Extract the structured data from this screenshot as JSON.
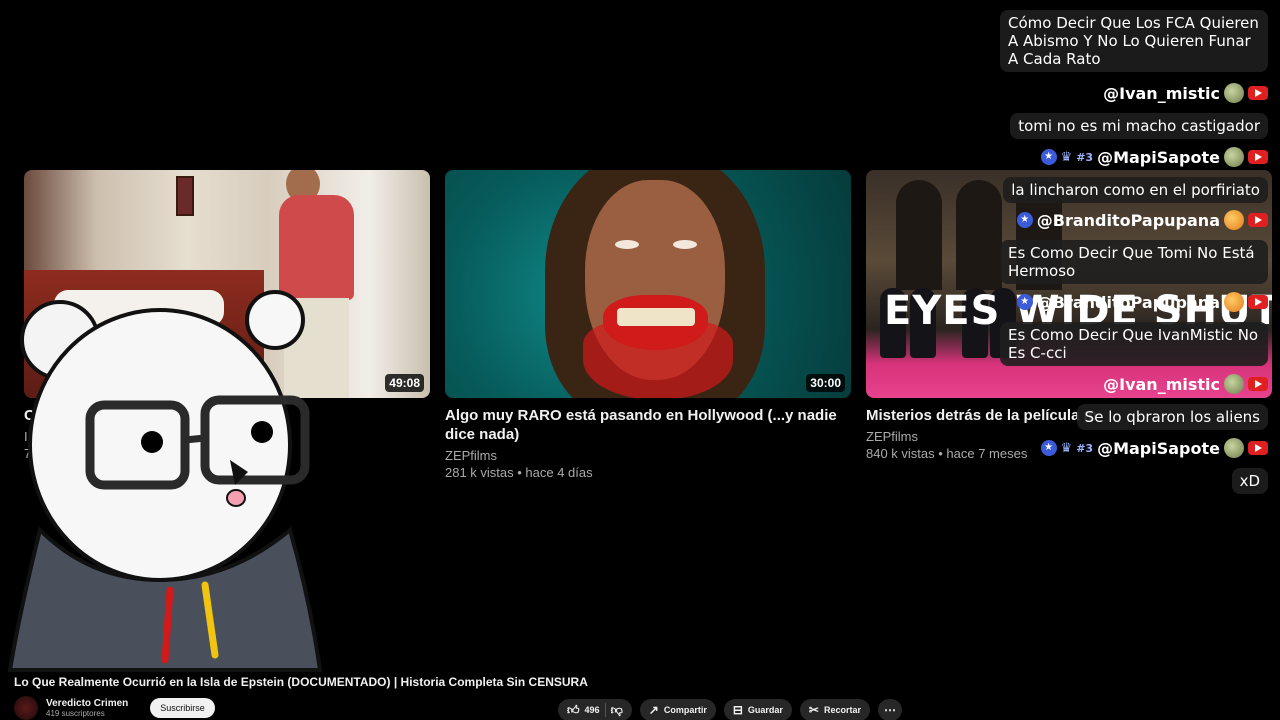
{
  "recommendations": [
    {
      "title": "Ca",
      "channel": "In",
      "meta": "7.",
      "duration": "49:08"
    },
    {
      "title": "Algo muy RARO está pasando en Hollywood (...y nadie dice nada)",
      "channel": "ZEPfilms",
      "meta": "281 k vistas • hace 4 días",
      "duration": "30:00"
    },
    {
      "title": "Misterios detrás de la película m",
      "channel": "ZEPfilms",
      "meta": "840 k vistas • hace 7 meses",
      "thumb_text": "EYES WIDE SHUT"
    }
  ],
  "chat": {
    "messages": [
      {
        "text": "Cómo Decir Que Los FCA Quieren A Abismo Y No Lo Quieren Funar A Cada Rato"
      },
      {
        "author": "@Ivan_mistic",
        "text": "tomi no es mi macho castigador"
      },
      {
        "author": "@MapiSapote",
        "badge": "#3",
        "text": "la lincharon como en el porfiriato"
      },
      {
        "author": "@BranditoPapupana",
        "text": "Es Como Decir Que Tomi No Está Hermoso"
      },
      {
        "author": "@BranditoPapupana",
        "text": "Es Como Decir Que IvanMistic No Es C-cci"
      },
      {
        "author": "@Ivan_mistic",
        "text": "Se lo qbraron los aliens"
      },
      {
        "author": "@MapiSapote",
        "badge": "#3",
        "text": "xD"
      }
    ]
  },
  "video": {
    "title": "Lo Que Realmente Ocurrió en la Isla de Epstein (DOCUMENTADO) | Historia Completa Sin CENSURA",
    "channel_name": "Veredicto Crimen",
    "subscribers": "419 suscriptores",
    "subscribe_label": "Suscribirse",
    "likes": "496",
    "share_label": "Compartir",
    "save_label": "Guardar",
    "clip_label": "Recortar"
  },
  "icons": [
    "thumbs-up-icon",
    "thumbs-down-icon",
    "share-icon",
    "save-icon",
    "scissors-icon",
    "more-icon",
    "youtube-icon",
    "star-badge-icon",
    "crown-icon"
  ]
}
